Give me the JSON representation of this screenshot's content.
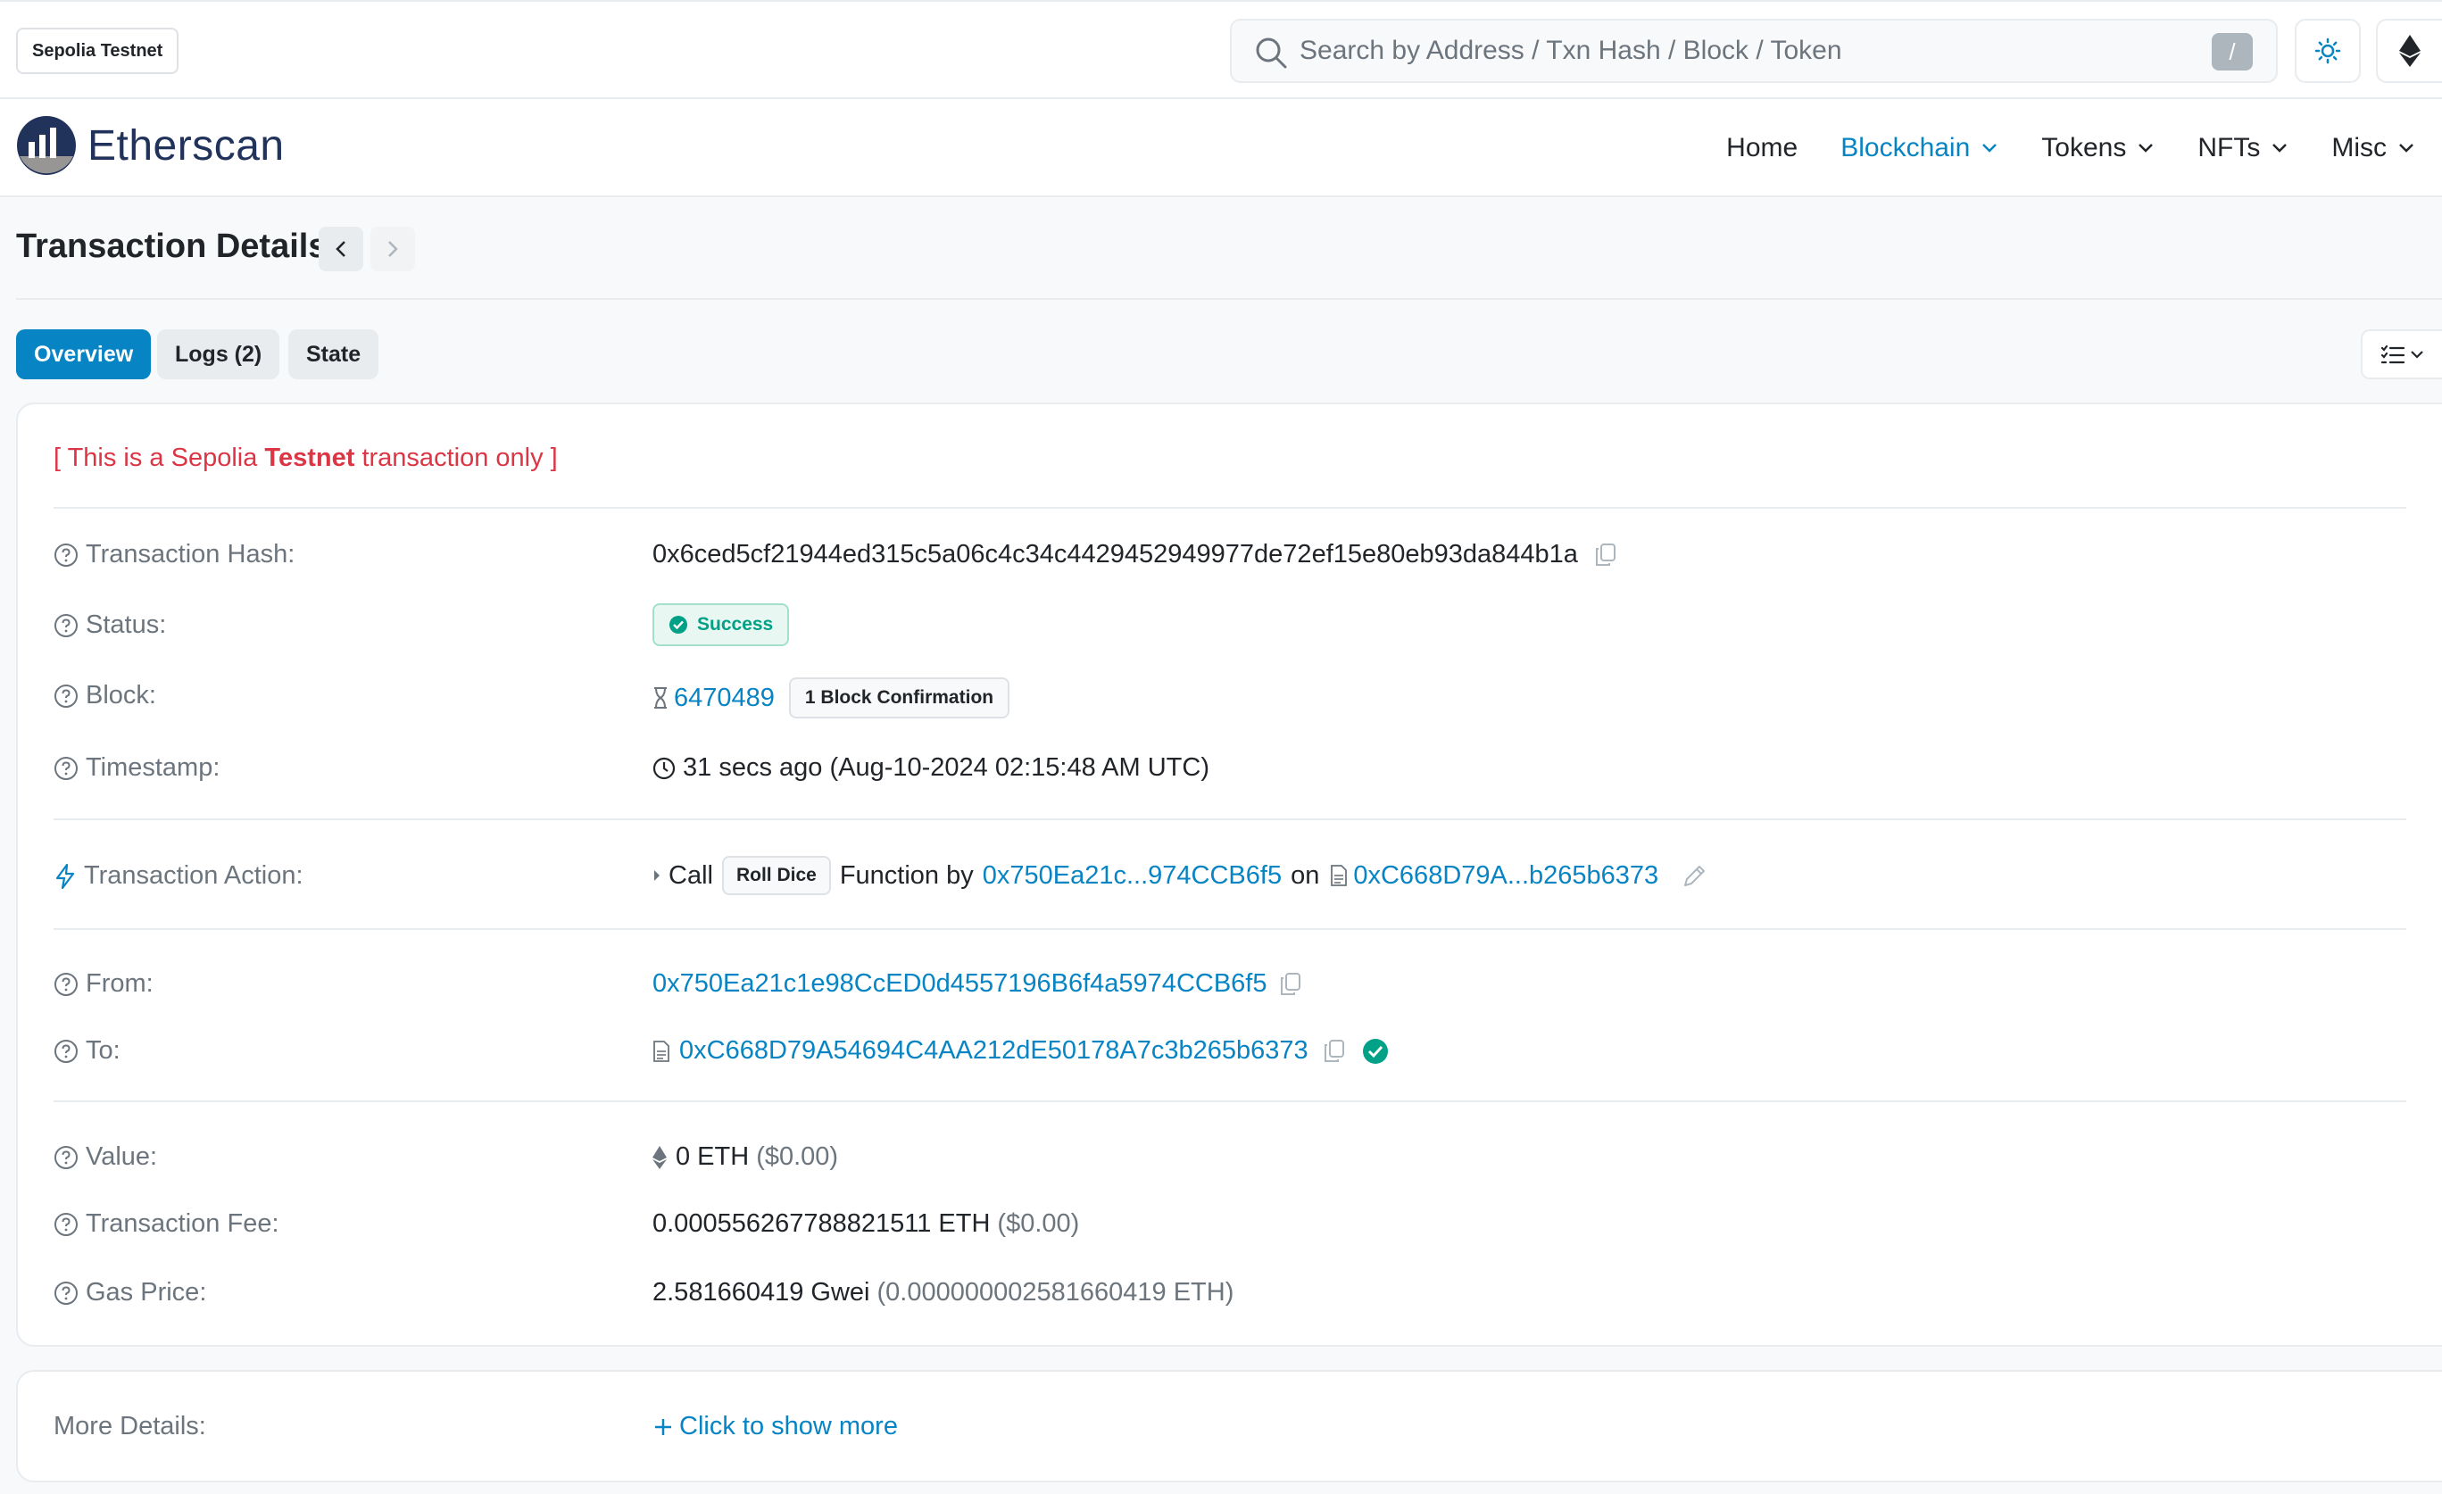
{
  "topbar": {
    "network_label": "Sepolia Testnet",
    "search_placeholder": "Search by Address / Txn Hash / Block / Token",
    "search_shortcut": "/"
  },
  "header": {
    "logo_text": "Etherscan",
    "nav": [
      {
        "label": "Home",
        "dropdown": false,
        "active": false
      },
      {
        "label": "Blockchain",
        "dropdown": true,
        "active": true
      },
      {
        "label": "Tokens",
        "dropdown": true,
        "active": false
      },
      {
        "label": "NFTs",
        "dropdown": true,
        "active": false
      },
      {
        "label": "Misc",
        "dropdown": true,
        "active": false
      }
    ]
  },
  "page": {
    "title": "Transaction Details"
  },
  "tabs": [
    {
      "label": "Overview",
      "active": true
    },
    {
      "label": "Logs (2)",
      "active": false
    },
    {
      "label": "State",
      "active": false
    }
  ],
  "notice": {
    "prefix": "[ This is a Sepolia ",
    "emphasis": "Testnet",
    "suffix": " transaction only ]"
  },
  "details": {
    "hash": {
      "label": "Transaction Hash:",
      "value": "0x6ced5cf21944ed315c5a06c4c34c4429452949977de72ef15e80eb93da844b1a"
    },
    "status": {
      "label": "Status:",
      "value": "Success"
    },
    "block": {
      "label": "Block:",
      "value": "6470489",
      "confirmations": "1 Block Confirmation"
    },
    "timestamp": {
      "label": "Timestamp:",
      "value": "31 secs ago (Aug-10-2024 02:15:48 AM UTC)"
    },
    "action": {
      "label": "Transaction Action:",
      "call": "Call",
      "method": "Roll Dice",
      "function_by": "Function by",
      "from_short": "0x750Ea21c...974CCB6f5",
      "on": "on",
      "to_short": "0xC668D79A...b265b6373"
    },
    "from": {
      "label": "From:",
      "value": "0x750Ea21c1e98CcED0d4557196B6f4a5974CCB6f5"
    },
    "to": {
      "label": "To:",
      "value": "0xC668D79A54694C4AA212dE50178A7c3b265b6373"
    },
    "value": {
      "label": "Value:",
      "amount": "0 ETH",
      "usd": "($0.00)"
    },
    "fee": {
      "label": "Transaction Fee:",
      "amount": "0.000556267788821511 ETH",
      "usd": "($0.00)"
    },
    "gas": {
      "label": "Gas Price:",
      "amount": "2.581660419 Gwei",
      "eth": "(0.000000002581660419 ETH)"
    }
  },
  "more": {
    "label": "More Details:",
    "link": "Click to show more"
  },
  "colors": {
    "accent": "#0784c3",
    "danger": "#dc3545",
    "success": "#00a186",
    "logo_navy": "#21325b"
  }
}
